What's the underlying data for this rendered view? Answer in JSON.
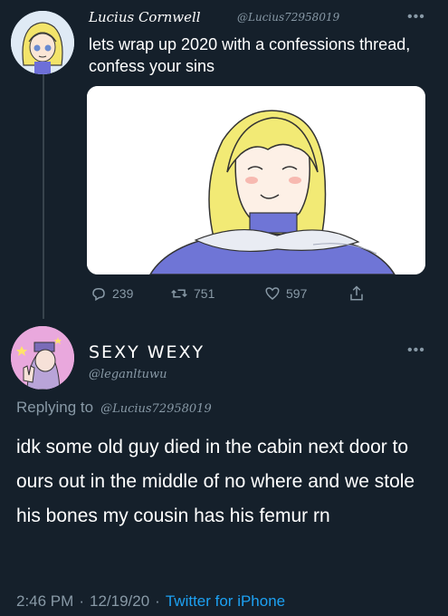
{
  "first_tweet": {
    "display_name": "Lucius Cornwell",
    "handle": "@Lucius72958019",
    "text": "lets wrap up 2020 with a confessions thread, confess your sins",
    "actions": {
      "reply_count": "239",
      "retweet_count": "751",
      "like_count": "597"
    }
  },
  "reply_tweet": {
    "display_name": "SEXY WEXY",
    "handle": "@leganltuwu",
    "replying_prefix": "Replying to",
    "replying_to": "@Lucius72958019",
    "text": "idk some old guy died in the cabin next door to ours out in the middle of no where and we stole his bones my cousin has his femur rn",
    "time": "2:46 PM",
    "date": "12/19/20",
    "separator": "·",
    "source": "Twitter for iPhone"
  },
  "colors": {
    "background": "#15202b",
    "muted": "#8899a6",
    "link": "#1da1f2",
    "divider": "#38444d"
  },
  "icons": [
    "reply-icon",
    "retweet-icon",
    "like-icon",
    "share-icon",
    "more-icon"
  ]
}
